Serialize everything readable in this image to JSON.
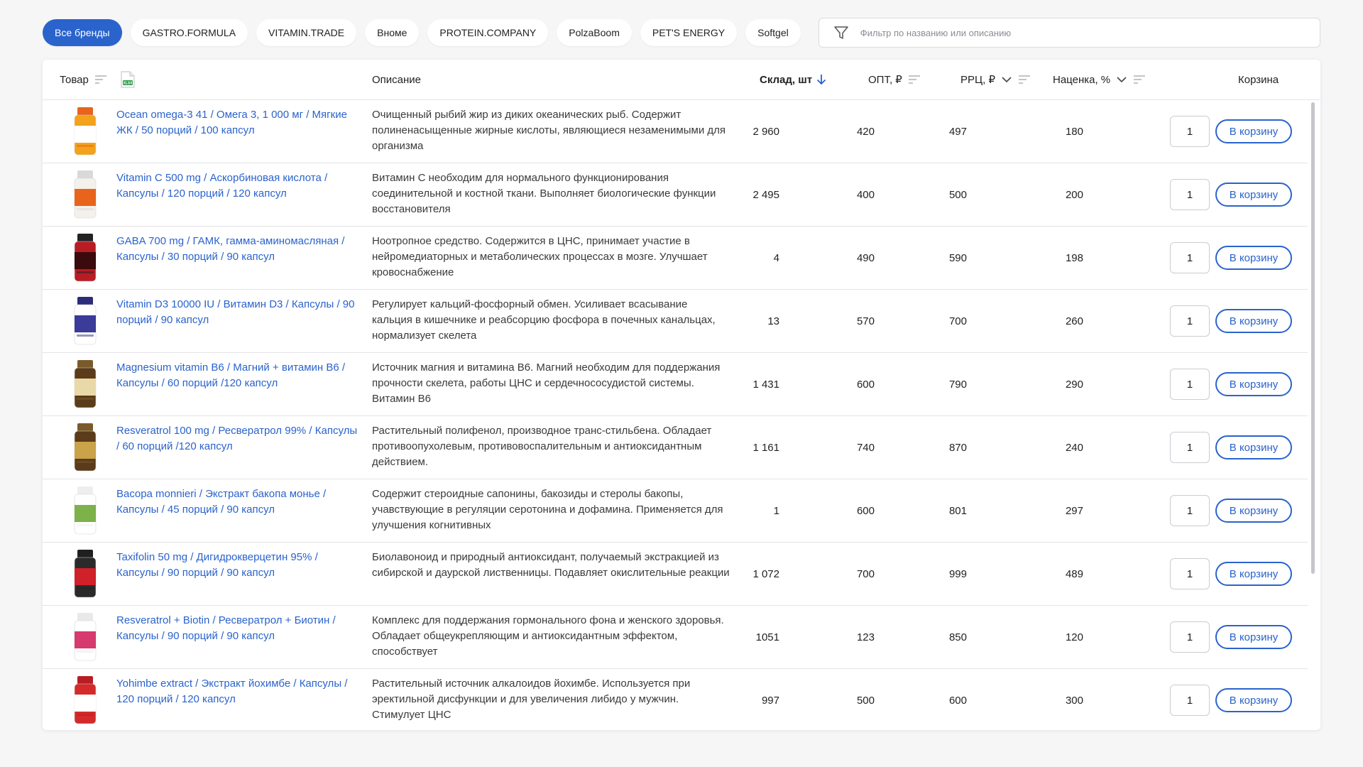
{
  "brands": [
    {
      "label": "Все бренды",
      "active": true
    },
    {
      "label": "GASTRO.FORMULA",
      "active": false
    },
    {
      "label": "VITAMIN.TRADE",
      "active": false
    },
    {
      "label": "Вноме",
      "active": false
    },
    {
      "label": "PROTEIN.COMPANY",
      "active": false
    },
    {
      "label": "PolzaBoom",
      "active": false
    },
    {
      "label": "PET'S ENERGY",
      "active": false
    },
    {
      "label": "Softgel",
      "active": false
    }
  ],
  "filter": {
    "placeholder": "Фильтр по названию или описанию",
    "value": ""
  },
  "table": {
    "headers": {
      "product": "Товар",
      "xlsx_badge": "XLSX",
      "description": "Описание",
      "stock": "Склад, шт",
      "opt": "ОПТ, ₽",
      "rrc": "РРЦ, ₽",
      "markup": "Наценка, %",
      "cart": "Корзина"
    },
    "add_label": "В корзину",
    "rows": [
      {
        "name": "Ocean omega-3 41 / Омега 3, 1 000 мг / Мягкие ЖК / 50 порций / 100 капсул",
        "description": "Очищенный рыбий жир из диких океанических рыб. Содержит полиненасыщенные жирные кислоты, являющиеся незаменимыми для организма",
        "stock": "2 960",
        "opt": "420",
        "rrc": "497",
        "markup": "180",
        "qty": "1",
        "image": {
          "icon": "fish-oil-bottle-icon",
          "cap": "#e8641c",
          "body": "#f2a21b",
          "label": "#ffffff",
          "text": "FISH OIL"
        }
      },
      {
        "name": "Vitamin C 500 mg / Аскорбиновая кислота / Капсулы / 120 порций / 120 капсул",
        "description": "Витамин С необходим для нормального функционирования соединительной и костной ткани. Выполняет биологические функции восстановителя",
        "stock": "2 495",
        "opt": "400",
        "rrc": "500",
        "markup": "200",
        "qty": "1",
        "image": {
          "icon": "vitamin-c-bottle-icon",
          "cap": "#d9d9d9",
          "body": "#f4f1ec",
          "label": "#e8641c",
          "text": "Vitamin C"
        }
      },
      {
        "name": "GABA 700 mg / ГАМК, гамма-аминомасляная / Капсулы / 30 порций / 90 капсул",
        "description": "Ноотропное средство. Содержится в ЦНС, принимает участие в нейромедиаторных и метаболических процессах в мозге. Улучшает кровоснабжение",
        "stock": "4",
        "opt": "490",
        "rrc": "590",
        "markup": "198",
        "qty": "1",
        "image": {
          "icon": "gaba-bottle-icon",
          "cap": "#222222",
          "body": "#b81d24",
          "label": "#3a0a0c",
          "text": "GABA"
        }
      },
      {
        "name": "Vitamin D3 10000 IU / Витамин D3 / Капсулы / 90 порций / 90 капсул",
        "description": "Регулирует кальций-фосфорный обмен. Усиливает всасывание кальция в кишечнике и реабсорцию фосфора в почечных канальцах, нормализует скелета",
        "stock": "13",
        "opt": "570",
        "rrc": "700",
        "markup": "260",
        "qty": "1",
        "image": {
          "icon": "vitamin-d3-bottle-icon",
          "cap": "#2c2c7a",
          "body": "#ffffff",
          "label": "#3b3b9a",
          "text": "D3"
        }
      },
      {
        "name": "Magnesium vitamin B6 / Магний + витамин В6 / Капсулы / 60 порций /120 капсул",
        "description": "Источник магния и витамина В6. Магний необходим для поддержания прочности скелета, работы ЦНС и сердечнососудистой системы. Витамин В6",
        "stock": "1 431",
        "opt": "600",
        "rrc": "790",
        "markup": "290",
        "qty": "1",
        "image": {
          "icon": "magnesium-bottle-icon",
          "cap": "#7a5a2a",
          "body": "#5b3b1a",
          "label": "#e9d9a8",
          "text": "MAGNESIUM"
        }
      },
      {
        "name": "Resveratrol 100 mg / Ресвератрол 99% / Капсулы / 60 порций /120 капсул",
        "description": "Растительный полифенол, производное транс-стильбена. Обладает противоопухолевым, противовоспалительным и антиоксидантным действием.",
        "stock": "1 161",
        "opt": "740",
        "rrc": "870",
        "markup": "240",
        "qty": "1",
        "image": {
          "icon": "resveratrol-bottle-icon",
          "cap": "#7a5a2a",
          "body": "#5b3b1a",
          "label": "#c9a24a",
          "text": "RESVERATROL"
        }
      },
      {
        "name": "Bacopa monnieri / Экстракт бакопа монье / Капсулы / 45 порций / 90 капсул",
        "description": "Содержит стероидные сапонины, бакозиды и стеролы бакопы, учавствующие в регуляции серотонина и дофамина. Применяется для улучшения когнитивных",
        "stock": "1",
        "opt": "600",
        "rrc": "801",
        "markup": "297",
        "qty": "1",
        "image": {
          "icon": "bacopa-bottle-icon",
          "cap": "#eeeeee",
          "body": "#ffffff",
          "label": "#7db14a",
          "text": "Bacopa"
        }
      },
      {
        "name": "Taxifolin 50 mg / Дигидрокверцетин 95% / Капсулы / 90 порций / 90 капсул",
        "description": "Биолавоноид и природный антиоксидант, получаемый экстракцией из сибирской и даурской лиственницы. Подавляет окислительные реакции",
        "stock": "1 072",
        "opt": "700",
        "rrc": "999",
        "markup": "489",
        "qty": "1",
        "image": {
          "icon": "taxifolin-bottle-icon",
          "cap": "#1f1f1f",
          "body": "#2a2a2a",
          "label": "#d0202a",
          "text": "TAXIFOLIN"
        }
      },
      {
        "name": "Resveratrol + Biotin / Ресвератрол + Биотин / Капсулы / 90 порций / 90 капсул",
        "description": "Комплекс для поддержания гормонального фона и женского здоровья. Обладает общеукрепляющим и антиоксидантным эффектом, способствует",
        "stock": "1051",
        "opt": "123",
        "rrc": "850",
        "markup": "120",
        "qty": "1",
        "image": {
          "icon": "biotin-bottle-icon",
          "cap": "#e9e9e9",
          "body": "#ffffff",
          "label": "#d63a6e",
          "text": "BIOTINA"
        }
      },
      {
        "name": "Yohimbe extract / Экстракт йохимбе / Капсулы / 120 порций / 120 капсул",
        "description": "Растительный источник алкалоидов йохимбе. Используется при эректильной дисфункции и для увеличения либидо у мужчин. Стимулует ЦНС",
        "stock": "997",
        "opt": "500",
        "rrc": "600",
        "markup": "300",
        "qty": "1",
        "image": {
          "icon": "yohimbe-bottle-icon",
          "cap": "#b81d24",
          "body": "#d42a2a",
          "label": "#ffffff",
          "text": "YOHIMBE"
        }
      }
    ]
  },
  "colors": {
    "accent": "#2a63cc",
    "border": "#e3e4e8",
    "xlsx_green": "#2e9b4a"
  },
  "icons": {
    "filter": "funnel-icon",
    "sort_desc": "arrow-down-icon",
    "sort_lines": "sort-lines-icon",
    "chevron": "chevron-down-icon",
    "xlsx": "xlsx-file-icon"
  }
}
